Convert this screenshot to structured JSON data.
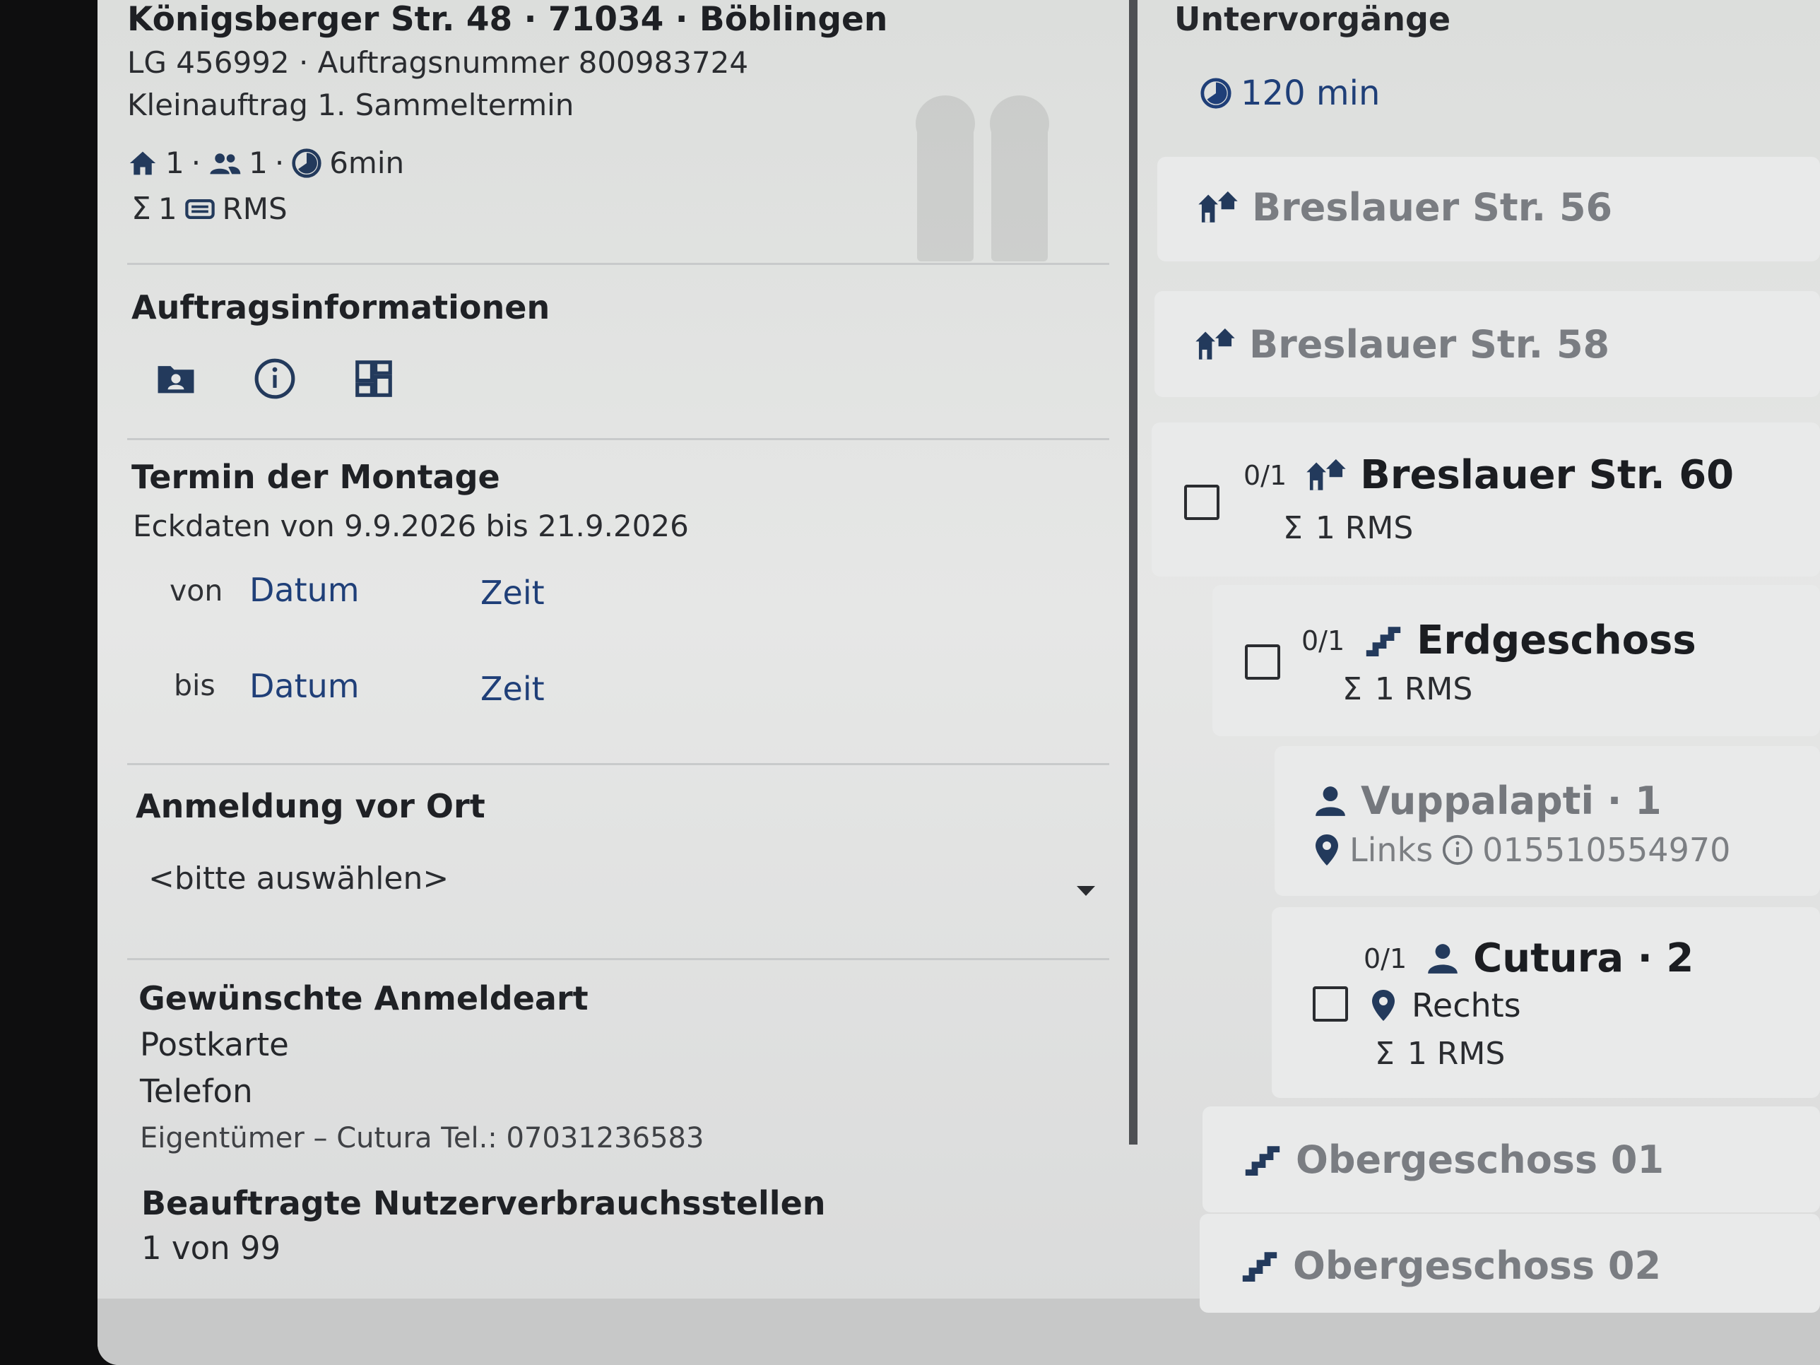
{
  "order": {
    "address": "Königsberger Str. 48 · 71034 · Böblingen",
    "ids": "LG 456992 · Auftragsnummer 800983724",
    "type": "Kleinauftrag 1. Sammeltermin",
    "stats": {
      "homes": "1",
      "persons": "1",
      "duration": "6min",
      "sum": "1",
      "sum_unit": "RMS"
    }
  },
  "auftragsinformationen": {
    "title": "Auftragsinformationen",
    "icons": [
      "folder-person-icon",
      "info-icon",
      "dashboard-icon"
    ]
  },
  "termin": {
    "title": "Termin der Montage",
    "eckdaten": "Eckdaten von 9.9.2026 bis 21.9.2026",
    "von_label": "von",
    "bis_label": "bis",
    "date_link": "Datum",
    "time_link": "Zeit"
  },
  "anmeldung": {
    "title": "Anmeldung vor Ort",
    "select_value": "<bitte auswählen>"
  },
  "anmeldeart": {
    "title": "Gewünschte Anmeldeart",
    "options": [
      "Postkarte",
      "Telefon"
    ],
    "contact": "Eigentümer –  Cutura Tel.:  07031236583"
  },
  "nutzer": {
    "title": "Beauftragte Nutzerverbrauchsstellen",
    "value": "1 von 99"
  },
  "untervorgaenge": {
    "title": "Untervorgänge",
    "duration": "120 min",
    "items": [
      {
        "title": "Breslauer Str. 56"
      },
      {
        "title": "Breslauer Str. 58"
      },
      {
        "progress": "0/1",
        "title": "Breslauer Str. 60",
        "sum": "1 RMS"
      },
      {
        "progress": "0/1",
        "title": "Erdgeschoss",
        "sum": "1 RMS"
      },
      {
        "title": "Vuppalapti · 1",
        "location": "Links",
        "phone": "015510554970"
      },
      {
        "progress": "0/1",
        "title": "Cutura · 2",
        "location": "Rechts",
        "sum": "1 RMS"
      },
      {
        "title": "Obergeschoss 01"
      },
      {
        "title": "Obergeschoss 02"
      }
    ]
  },
  "colors": {
    "accent": "#1f3f78",
    "icon": "#233a5c",
    "text": "#25272b"
  }
}
